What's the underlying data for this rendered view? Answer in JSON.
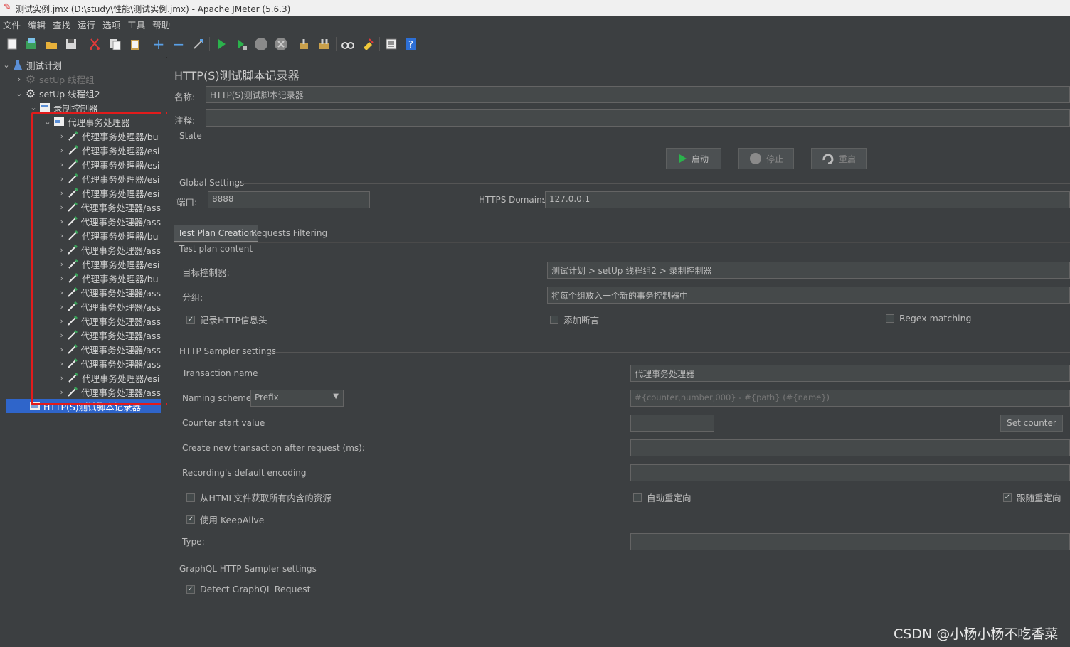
{
  "window": {
    "title": "测试实例.jmx (D:\\study\\性能\\测试实例.jmx) - Apache JMeter (5.6.3)"
  },
  "menu": [
    "文件",
    "编辑",
    "查找",
    "运行",
    "选项",
    "工具",
    "帮助"
  ],
  "toolbar": {
    "icons": [
      "new-icon",
      "templates-icon",
      "open-icon",
      "save-icon",
      "cut-icon",
      "copy-icon",
      "paste-icon",
      "expand-icon",
      "collapse-icon",
      "toggle-icon",
      "start-icon",
      "start-no-pause-icon",
      "stop-icon",
      "shutdown-icon",
      "clear-icon",
      "clear-all-icon",
      "search-icon",
      "reset-search-icon",
      "function-helper-icon",
      "help-icon"
    ]
  },
  "tree": {
    "root": "测试计划",
    "setup1": "setUp 线程组",
    "setup2": "setUp 线程组2",
    "recorder_ctrl": "录制控制器",
    "tx_ctrl": "代理事务处理器",
    "children": [
      "代理事务处理器/bu",
      "代理事务处理器/esi",
      "代理事务处理器/esi",
      "代理事务处理器/esi",
      "代理事务处理器/esi",
      "代理事务处理器/ass",
      "代理事务处理器/ass",
      "代理事务处理器/bu",
      "代理事务处理器/ass",
      "代理事务处理器/esi",
      "代理事务处理器/bu",
      "代理事务处理器/ass",
      "代理事务处理器/ass",
      "代理事务处理器/ass",
      "代理事务处理器/ass",
      "代理事务处理器/ass",
      "代理事务处理器/ass",
      "代理事务处理器/esi",
      "代理事务处理器/ass"
    ],
    "selected": "HTTP(S)测试脚本记录器"
  },
  "panel": {
    "title": "HTTP(S)测试脚本记录器",
    "name_label": "名称:",
    "name_value": "HTTP(S)测试脚本记录器",
    "comment_label": "注释:",
    "comment_value": "",
    "state_label": "State",
    "start_btn": "启动",
    "stop_btn": "停止",
    "restart_btn": "重启",
    "global_label": "Global Settings",
    "port_label": "端口:",
    "port_value": "8888",
    "https_label": "HTTPS Domains:",
    "https_value": "127.0.0.1",
    "tabs": [
      "Test Plan Creation",
      "Requests Filtering"
    ],
    "content_label": "Test plan content",
    "target_label": "目标控制器:",
    "target_value": "测试计划 > setUp 线程组2 > 录制控制器",
    "group_label": "分组:",
    "group_value": "将每个组放入一个新的事务控制器中",
    "cb_headers": "记录HTTP信息头",
    "cb_assert": "添加断言",
    "cb_regex": "Regex matching",
    "sampler_label": "HTTP Sampler settings",
    "txname_label": "Transaction name",
    "txname_value": "代理事务处理器",
    "naming_label": "Naming scheme",
    "naming_value": "Prefix",
    "naming_format": "#{counter,number,000} - #{path} (#{name})",
    "counter_label": "Counter start value",
    "counter_value": "",
    "set_counter": "Set counter",
    "newtx_label": "Create new transaction after request (ms):",
    "encoding_label": "Recording's default encoding",
    "cb_fetch": "从HTML文件获取所有内含的资源",
    "cb_autoredirect": "自动重定向",
    "cb_follow": "跟随重定向",
    "cb_keepalive": "使用 KeepAlive",
    "type_label": "Type:",
    "graphql_label": "GraphQL HTTP Sampler settings",
    "cb_graphql": "Detect GraphQL Request"
  },
  "watermark": "CSDN @小杨小杨不吃香菜"
}
